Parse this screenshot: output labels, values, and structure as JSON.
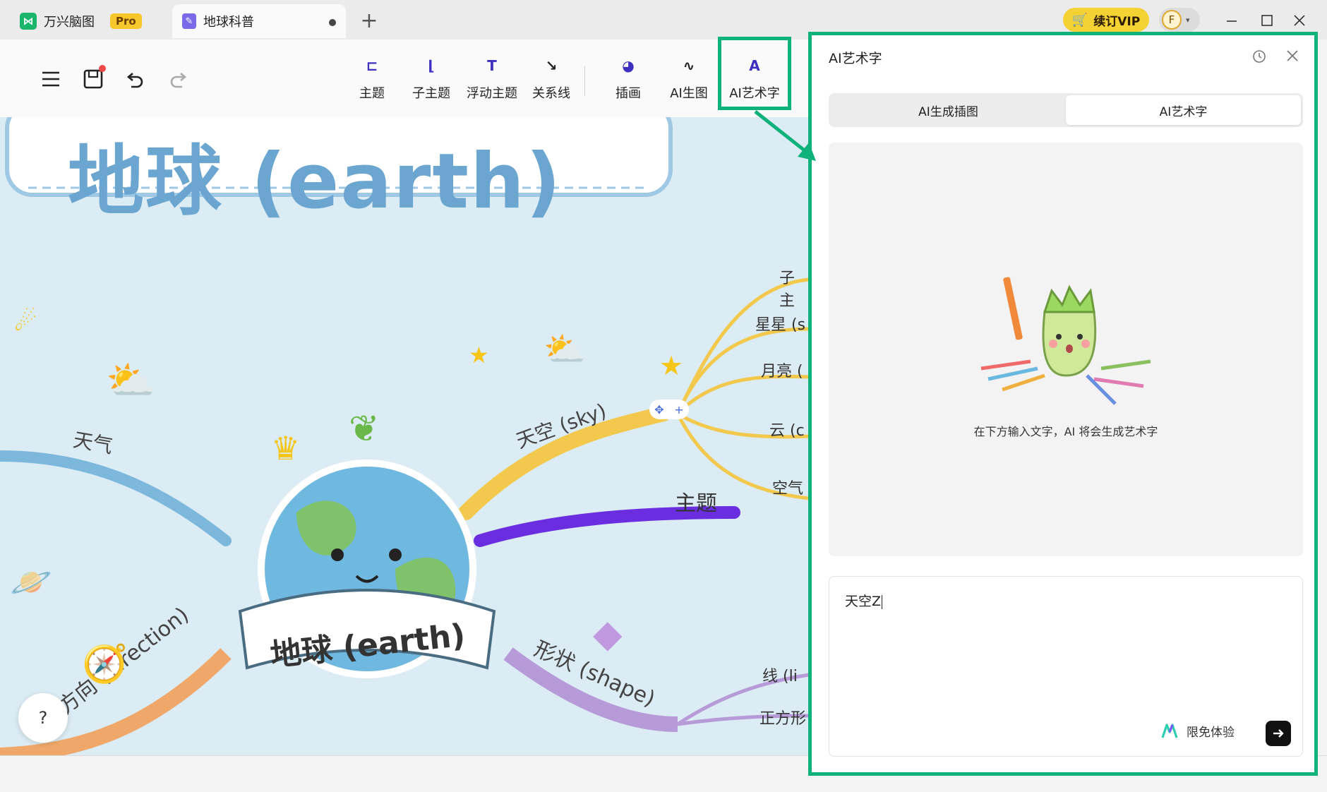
{
  "titlebar": {
    "app_tab": "万兴脑图",
    "pro_badge": "Pro",
    "doc_tab": "地球科普",
    "new_tab": "+",
    "vip_button": "续订VIP",
    "avatar_initial": "F"
  },
  "toolbar": {
    "tools": [
      {
        "label": "主题",
        "icon": "topic-icon"
      },
      {
        "label": "子主题",
        "icon": "subtopic-icon"
      },
      {
        "label": "浮动主题",
        "icon": "floating-topic-icon"
      },
      {
        "label": "关系线",
        "icon": "relationship-icon"
      },
      {
        "label": "插画",
        "icon": "illustration-icon"
      },
      {
        "label": "AI生图",
        "icon": "ai-image-icon"
      },
      {
        "label": "AI艺术字",
        "icon": "ai-art-text-icon"
      }
    ]
  },
  "canvas": {
    "banner_title": "地球 (earth)",
    "center_label": "地球 (earth)",
    "branches": {
      "sky": "天空 (sky)",
      "weather": "天气",
      "topic": "主题",
      "shape": "形状 (shape)",
      "direction": "方向 (direction)"
    },
    "sky_children": [
      "子主",
      "星星 (s",
      "月亮 (",
      "云 (c",
      "空气"
    ],
    "shape_children": [
      "线 (li",
      "正方形"
    ],
    "help": "?"
  },
  "ai_panel": {
    "title": "AI艺术字",
    "tabs": [
      {
        "label": "AI生成插图",
        "active": false
      },
      {
        "label": "AI艺术字",
        "active": true
      }
    ],
    "hint": "在下方输入文字，AI 将会生成艺术字",
    "input_value": "天空Z",
    "trial_label": "限免体验"
  },
  "colors": {
    "highlight": "#0fb27b",
    "sky_branch": "#f2c94c",
    "topic_branch": "#6a2de0",
    "weather_branch": "#7cb8dc",
    "shape_branch": "#b79ad8",
    "direction_branch": "#f0a86a"
  }
}
